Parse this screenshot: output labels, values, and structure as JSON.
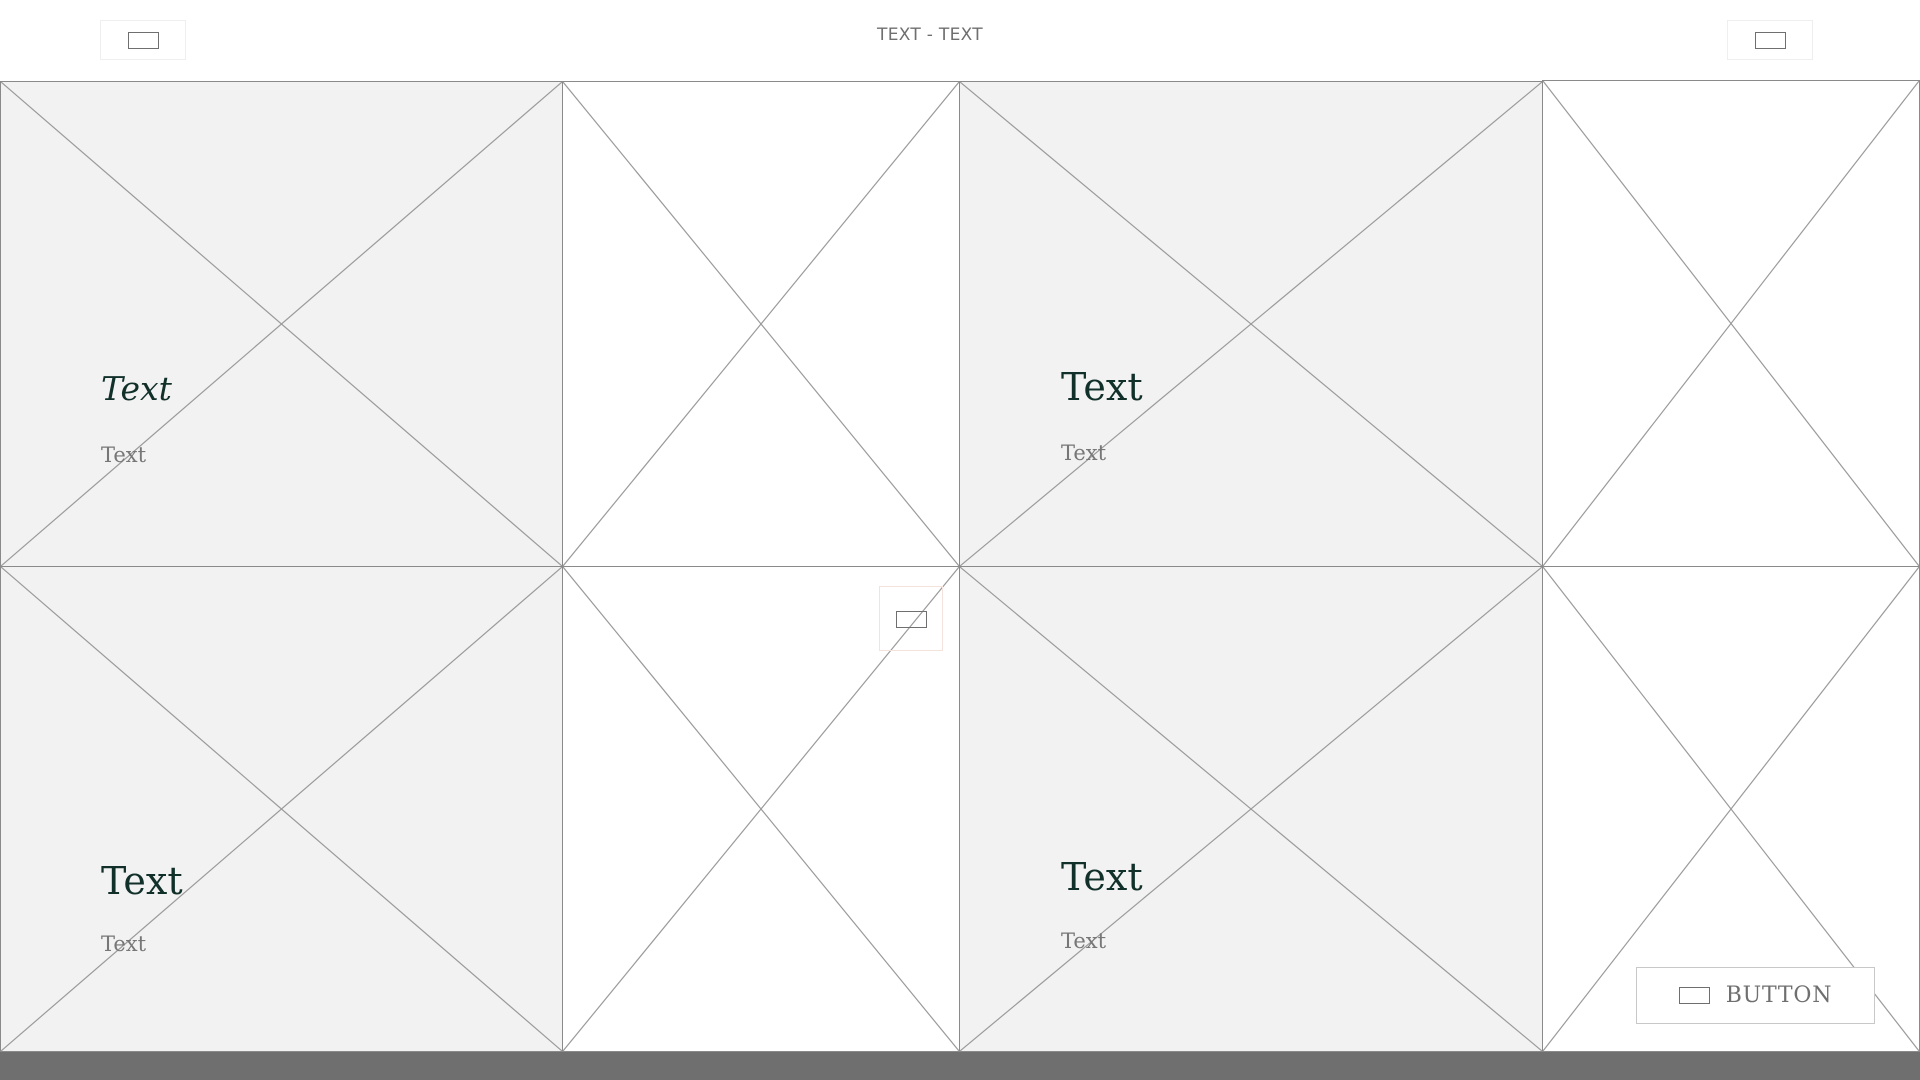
{
  "header": {
    "title": "TEXT - TEXT",
    "left_icon": "menu-icon",
    "right_icon": "cart-icon"
  },
  "tiles": [
    {
      "title": "Text",
      "subtitle": "Text"
    },
    {
      "title": "Text",
      "subtitle": "Text"
    },
    {
      "title": "Text",
      "subtitle": "Text"
    },
    {
      "title": "Text",
      "subtitle": "Text"
    }
  ],
  "floating_icon": "image-icon",
  "cta": {
    "label": "BUTTON",
    "icon": "button-icon"
  },
  "colors": {
    "tile_gray": "#f2f2f2",
    "title_text": "#11302a",
    "muted_text": "#777777",
    "footer_bar": "#6f6f6f"
  }
}
